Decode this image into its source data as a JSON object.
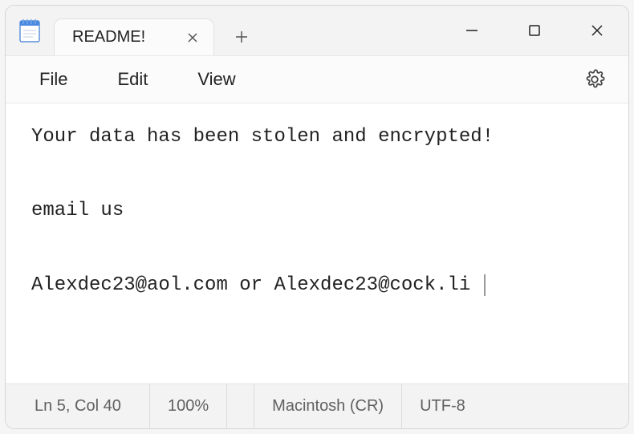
{
  "titlebar": {
    "tab_title": "README!",
    "icons": {
      "close_tab": "close-icon",
      "new_tab": "plus-icon",
      "minimize": "minimize-icon",
      "maximize": "maximize-icon",
      "close": "close-icon"
    }
  },
  "menubar": {
    "items": [
      {
        "label": "File"
      },
      {
        "label": "Edit"
      },
      {
        "label": "View"
      }
    ],
    "settings_icon": "gear-icon"
  },
  "document": {
    "lines": [
      "Your data has been stolen and encrypted!",
      "",
      "email us",
      "",
      "Alexdec23@aol.com or Alexdec23@cock.li"
    ]
  },
  "statusbar": {
    "position": "Ln 5, Col 40",
    "zoom": "100%",
    "line_ending": "Macintosh (CR)",
    "encoding": "UTF-8"
  }
}
